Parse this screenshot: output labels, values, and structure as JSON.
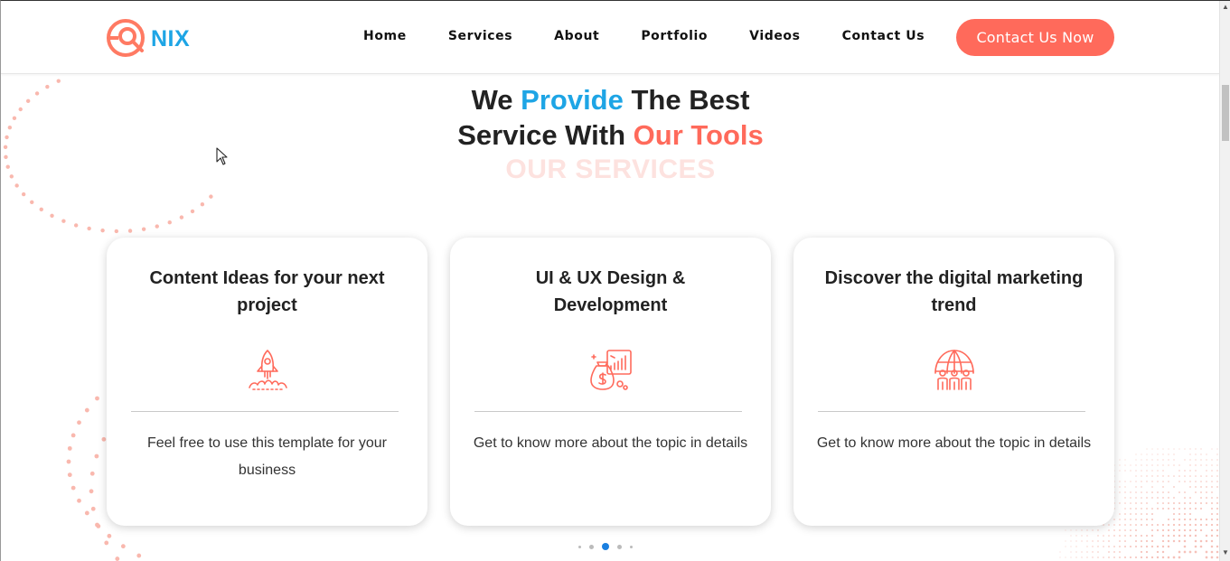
{
  "brand": {
    "name": "NIX",
    "logo_icon": "target-magnifier-icon"
  },
  "nav": {
    "items": [
      {
        "label": "Home"
      },
      {
        "label": "Services"
      },
      {
        "label": "About"
      },
      {
        "label": "Portfolio"
      },
      {
        "label": "Videos"
      },
      {
        "label": "Contact Us"
      }
    ],
    "cta_label": "Contact Us Now"
  },
  "section": {
    "title_part1": "We ",
    "title_highlight1": "Provide",
    "title_part2": " The Best",
    "title_part3": "Service With ",
    "title_highlight2": "Our Tools",
    "subtitle": "OUR SERVICES"
  },
  "cards": [
    {
      "title": "Content Ideas for your next project",
      "icon": "rocket-icon",
      "text": "Feel free to use this template for your business"
    },
    {
      "title": "UI & UX Design & Development",
      "icon": "money-chart-icon",
      "text": "Get to know more about the topic in details"
    },
    {
      "title": "Discover the digital marketing trend",
      "icon": "globe-team-icon",
      "text": "Get to know more about the topic in details"
    }
  ],
  "carousel": {
    "total_dots": 5,
    "active_index": 2
  },
  "colors": {
    "brand_blue": "#1ea5e5",
    "accent_coral": "#ff6a5b",
    "subtitle_pink": "#fde2df",
    "active_dot": "#1a7fe0"
  }
}
